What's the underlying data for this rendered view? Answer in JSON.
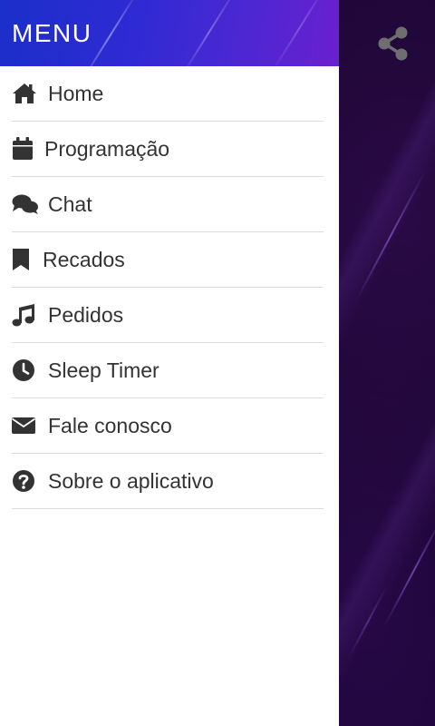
{
  "drawer": {
    "title": "MENU",
    "items": [
      {
        "label": "Home",
        "icon": "home-icon"
      },
      {
        "label": "Programação",
        "icon": "calendar-icon"
      },
      {
        "label": "Chat",
        "icon": "chat-icon"
      },
      {
        "label": "Recados",
        "icon": "bookmark-icon"
      },
      {
        "label": "Pedidos",
        "icon": "music-icon"
      },
      {
        "label": "Sleep Timer",
        "icon": "clock-icon"
      },
      {
        "label": "Fale conosco",
        "icon": "envelope-icon"
      },
      {
        "label": "Sobre o aplicativo",
        "icon": "question-circle-icon"
      }
    ]
  },
  "toolbar": {
    "share_icon": "share-icon"
  },
  "colors": {
    "header_gradient_start": "#1b2fc9",
    "header_gradient_end": "#6a1fd0",
    "icon": "#333333",
    "text": "#333333",
    "divider": "#dcdcdc",
    "share_icon": "#6e6e6e"
  }
}
